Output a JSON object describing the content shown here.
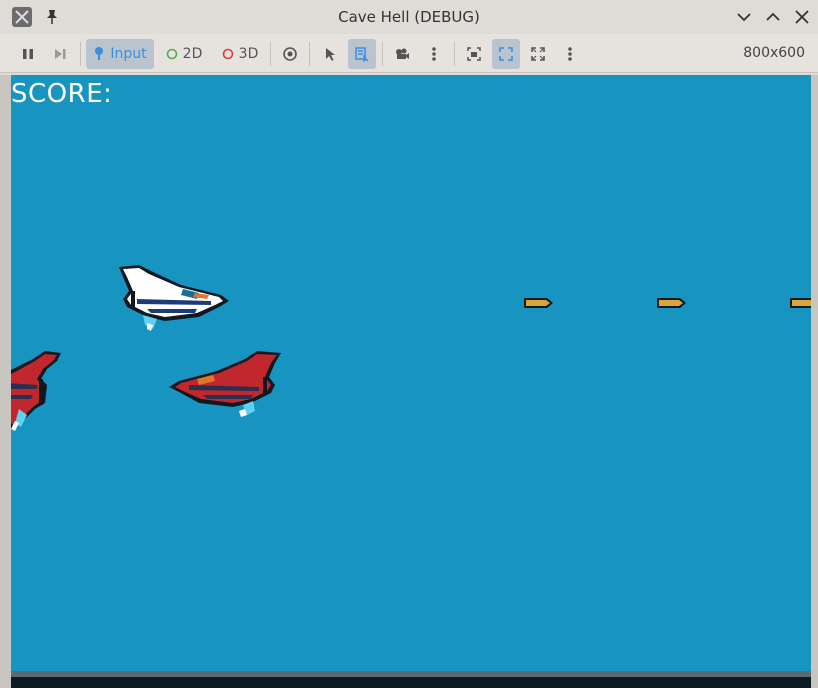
{
  "window": {
    "title": "Cave Hell (DEBUG)",
    "resolution": "800x600"
  },
  "toolbar": {
    "input_label": "Input",
    "mode_2d_label": "2D",
    "mode_3d_label": "3D"
  },
  "game": {
    "score_label": "SCORE:",
    "colors": {
      "sky": "#1894c0",
      "player_white": "#ffffff",
      "enemy_red": "#c1272d",
      "bullet_gold": "#d6a83a"
    }
  }
}
